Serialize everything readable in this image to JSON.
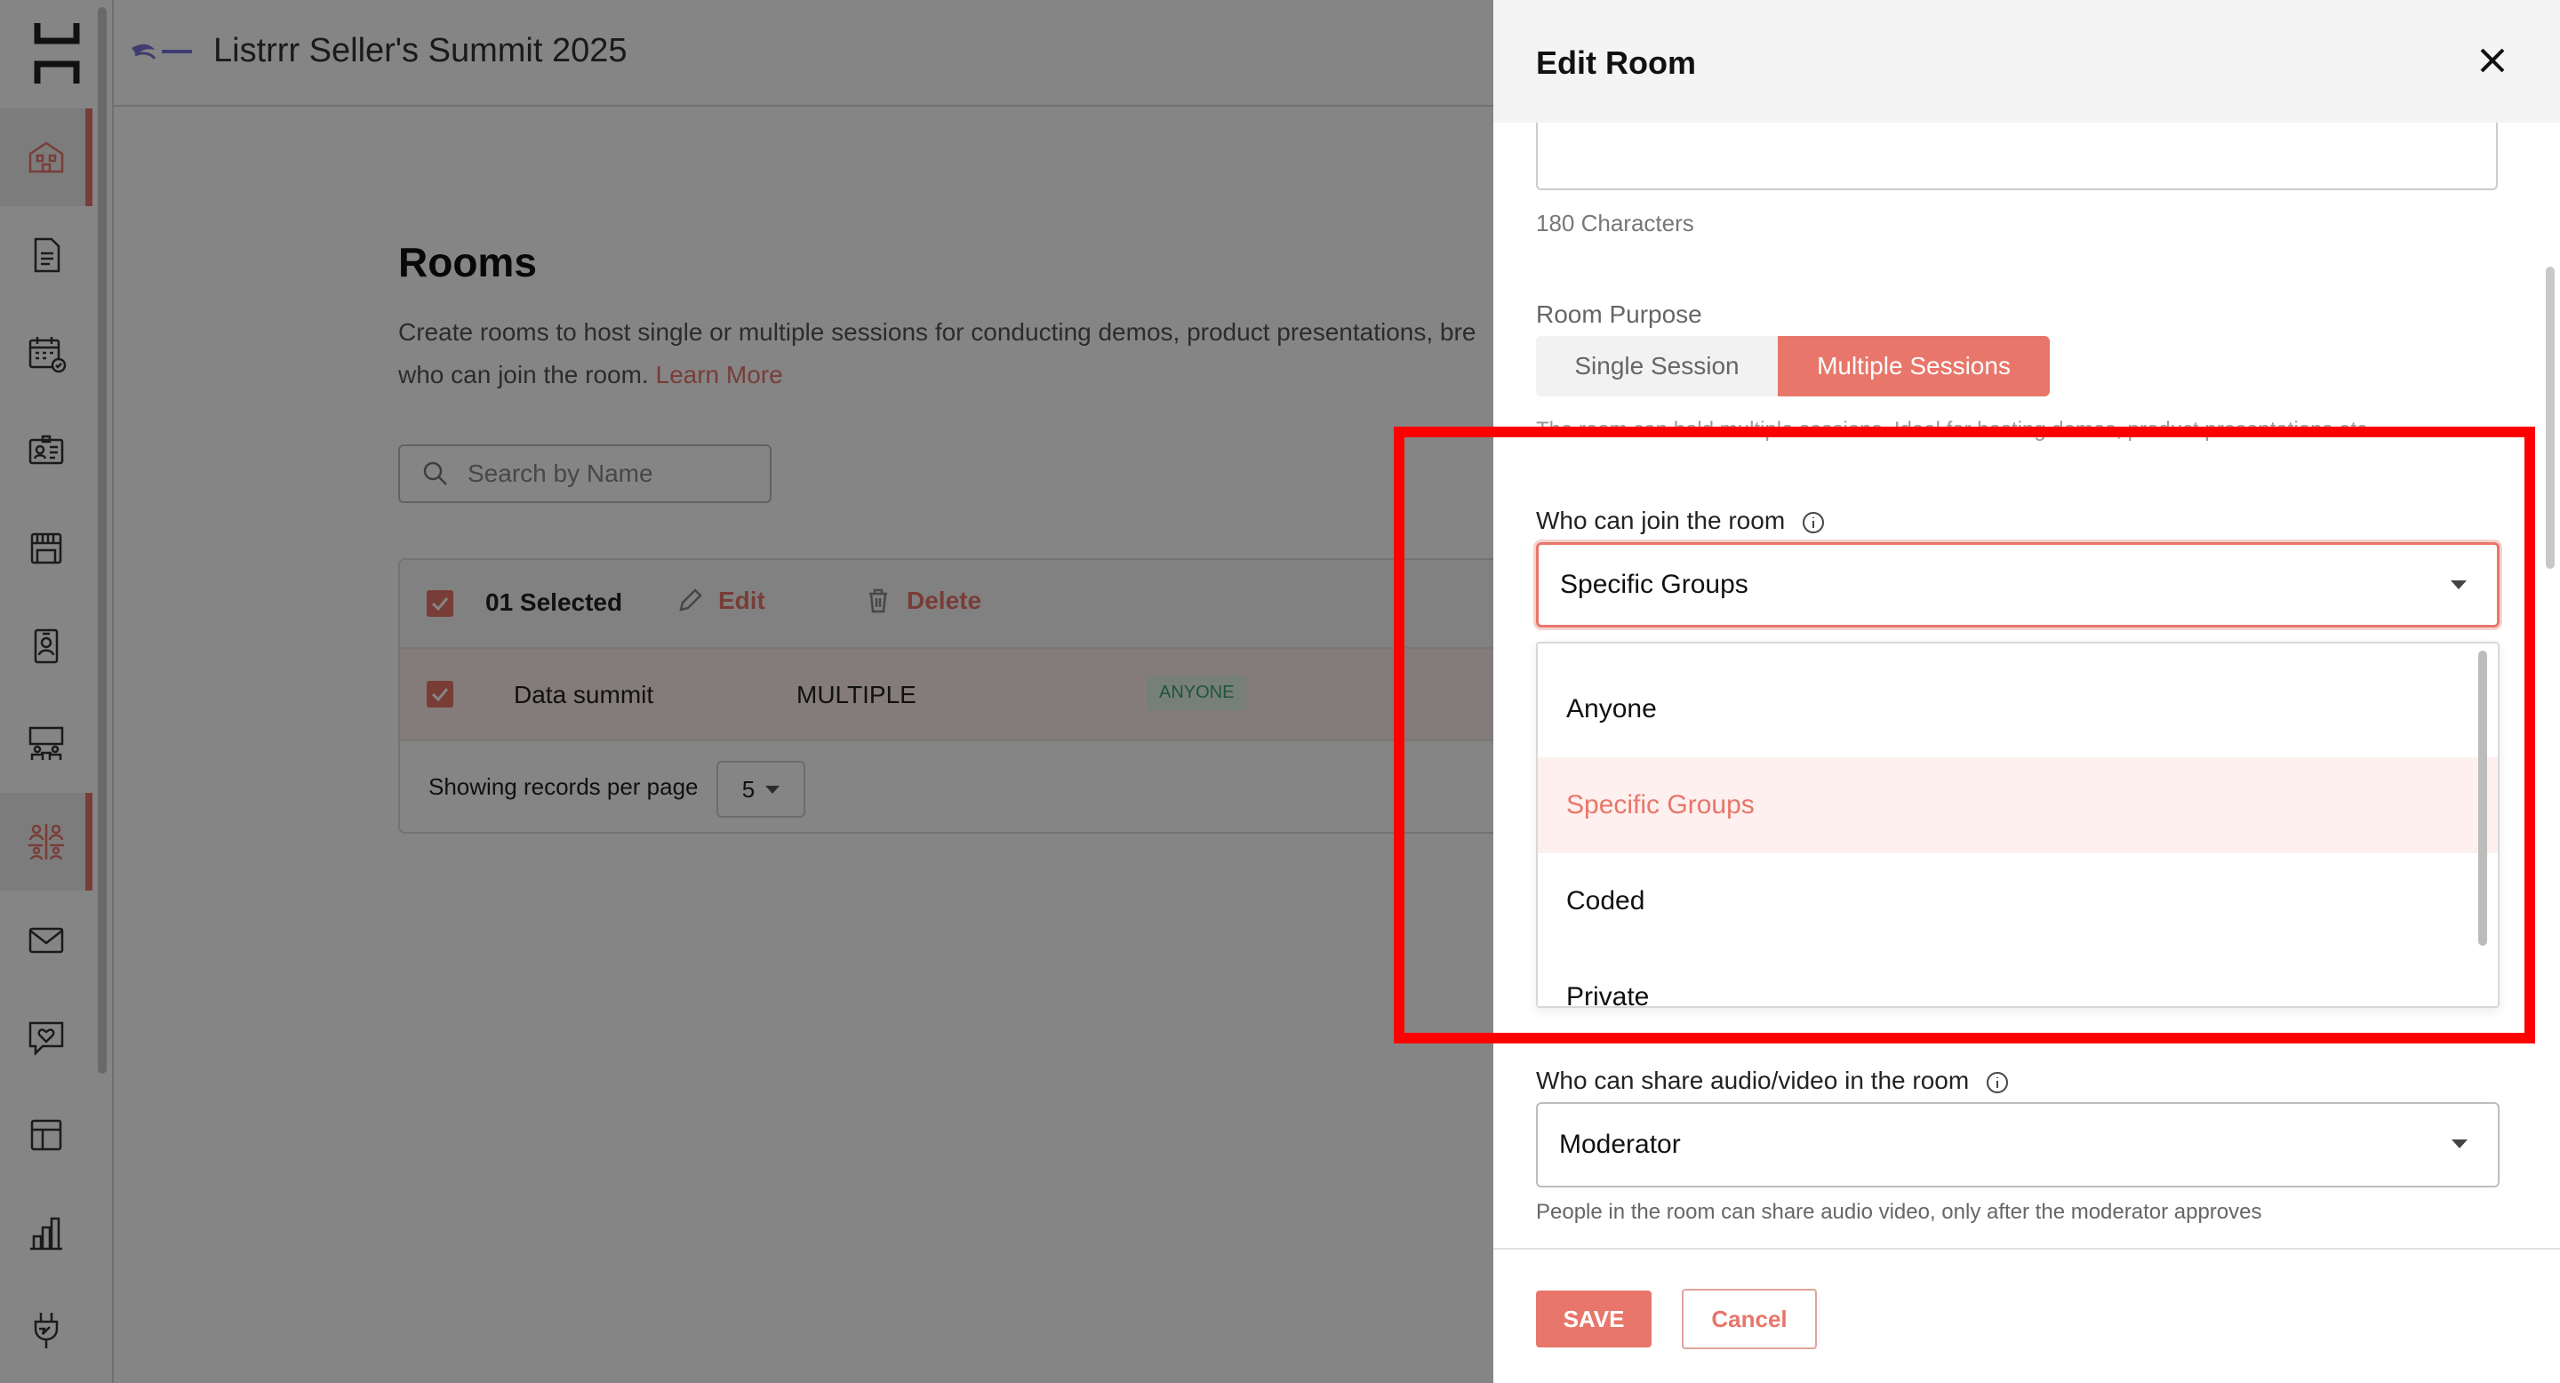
{
  "app": {
    "event_title": "Listrrr Seller's Summit 2025"
  },
  "rail": {
    "items": [
      {
        "icon": "building-icon",
        "active": true
      },
      {
        "icon": "document-icon",
        "active": false
      },
      {
        "icon": "calendar-icon",
        "active": false
      },
      {
        "icon": "id-card-icon",
        "active": false
      },
      {
        "icon": "booth-icon",
        "active": false
      },
      {
        "icon": "badge-icon",
        "active": false
      },
      {
        "icon": "lounge-icon",
        "active": false
      },
      {
        "icon": "rooms-icon",
        "active": true
      },
      {
        "icon": "mail-icon",
        "active": false
      },
      {
        "icon": "chat-heart-icon",
        "active": false
      },
      {
        "icon": "layout-icon",
        "active": false
      },
      {
        "icon": "analytics-icon",
        "active": false
      },
      {
        "icon": "plug-icon",
        "active": false
      }
    ]
  },
  "page": {
    "title": "Rooms",
    "description": "Create rooms to host single or multiple sessions for conducting demos, product presentations, bre",
    "description_line2": "who can join the room.",
    "learn_more": "Learn More",
    "search_placeholder": "Search by Name"
  },
  "table": {
    "selected_text": "01 Selected",
    "edit_label": "Edit",
    "delete_label": "Delete",
    "rows": [
      {
        "name": "Data summit",
        "purpose": "MULTIPLE",
        "access": "ANYONE"
      }
    ],
    "per_page_label": "Showing records per page",
    "per_page_value": "5"
  },
  "drawer": {
    "title": "Edit Room",
    "char_count": "180 Characters",
    "room_purpose_label": "Room Purpose",
    "purpose_options": [
      "Single Session",
      "Multiple Sessions"
    ],
    "purpose_selected": "Multiple Sessions",
    "purpose_helper": "The room can hold multiple sessions. Ideal for hosting demos, product presentations etc.",
    "join_label": "Who can join the room",
    "join_value": "Specific Groups",
    "join_options": [
      "Anyone",
      "Specific Groups",
      "Coded",
      "Private"
    ],
    "av_label": "Who can share audio/video in the room",
    "av_value": "Moderator",
    "av_helper": "People in the room can share audio video, only after the moderator approves",
    "save_label": "SAVE",
    "cancel_label": "Cancel"
  },
  "colors": {
    "accent": "#e8766a",
    "highlight": "#ff0000",
    "success": "#3fa36b"
  }
}
